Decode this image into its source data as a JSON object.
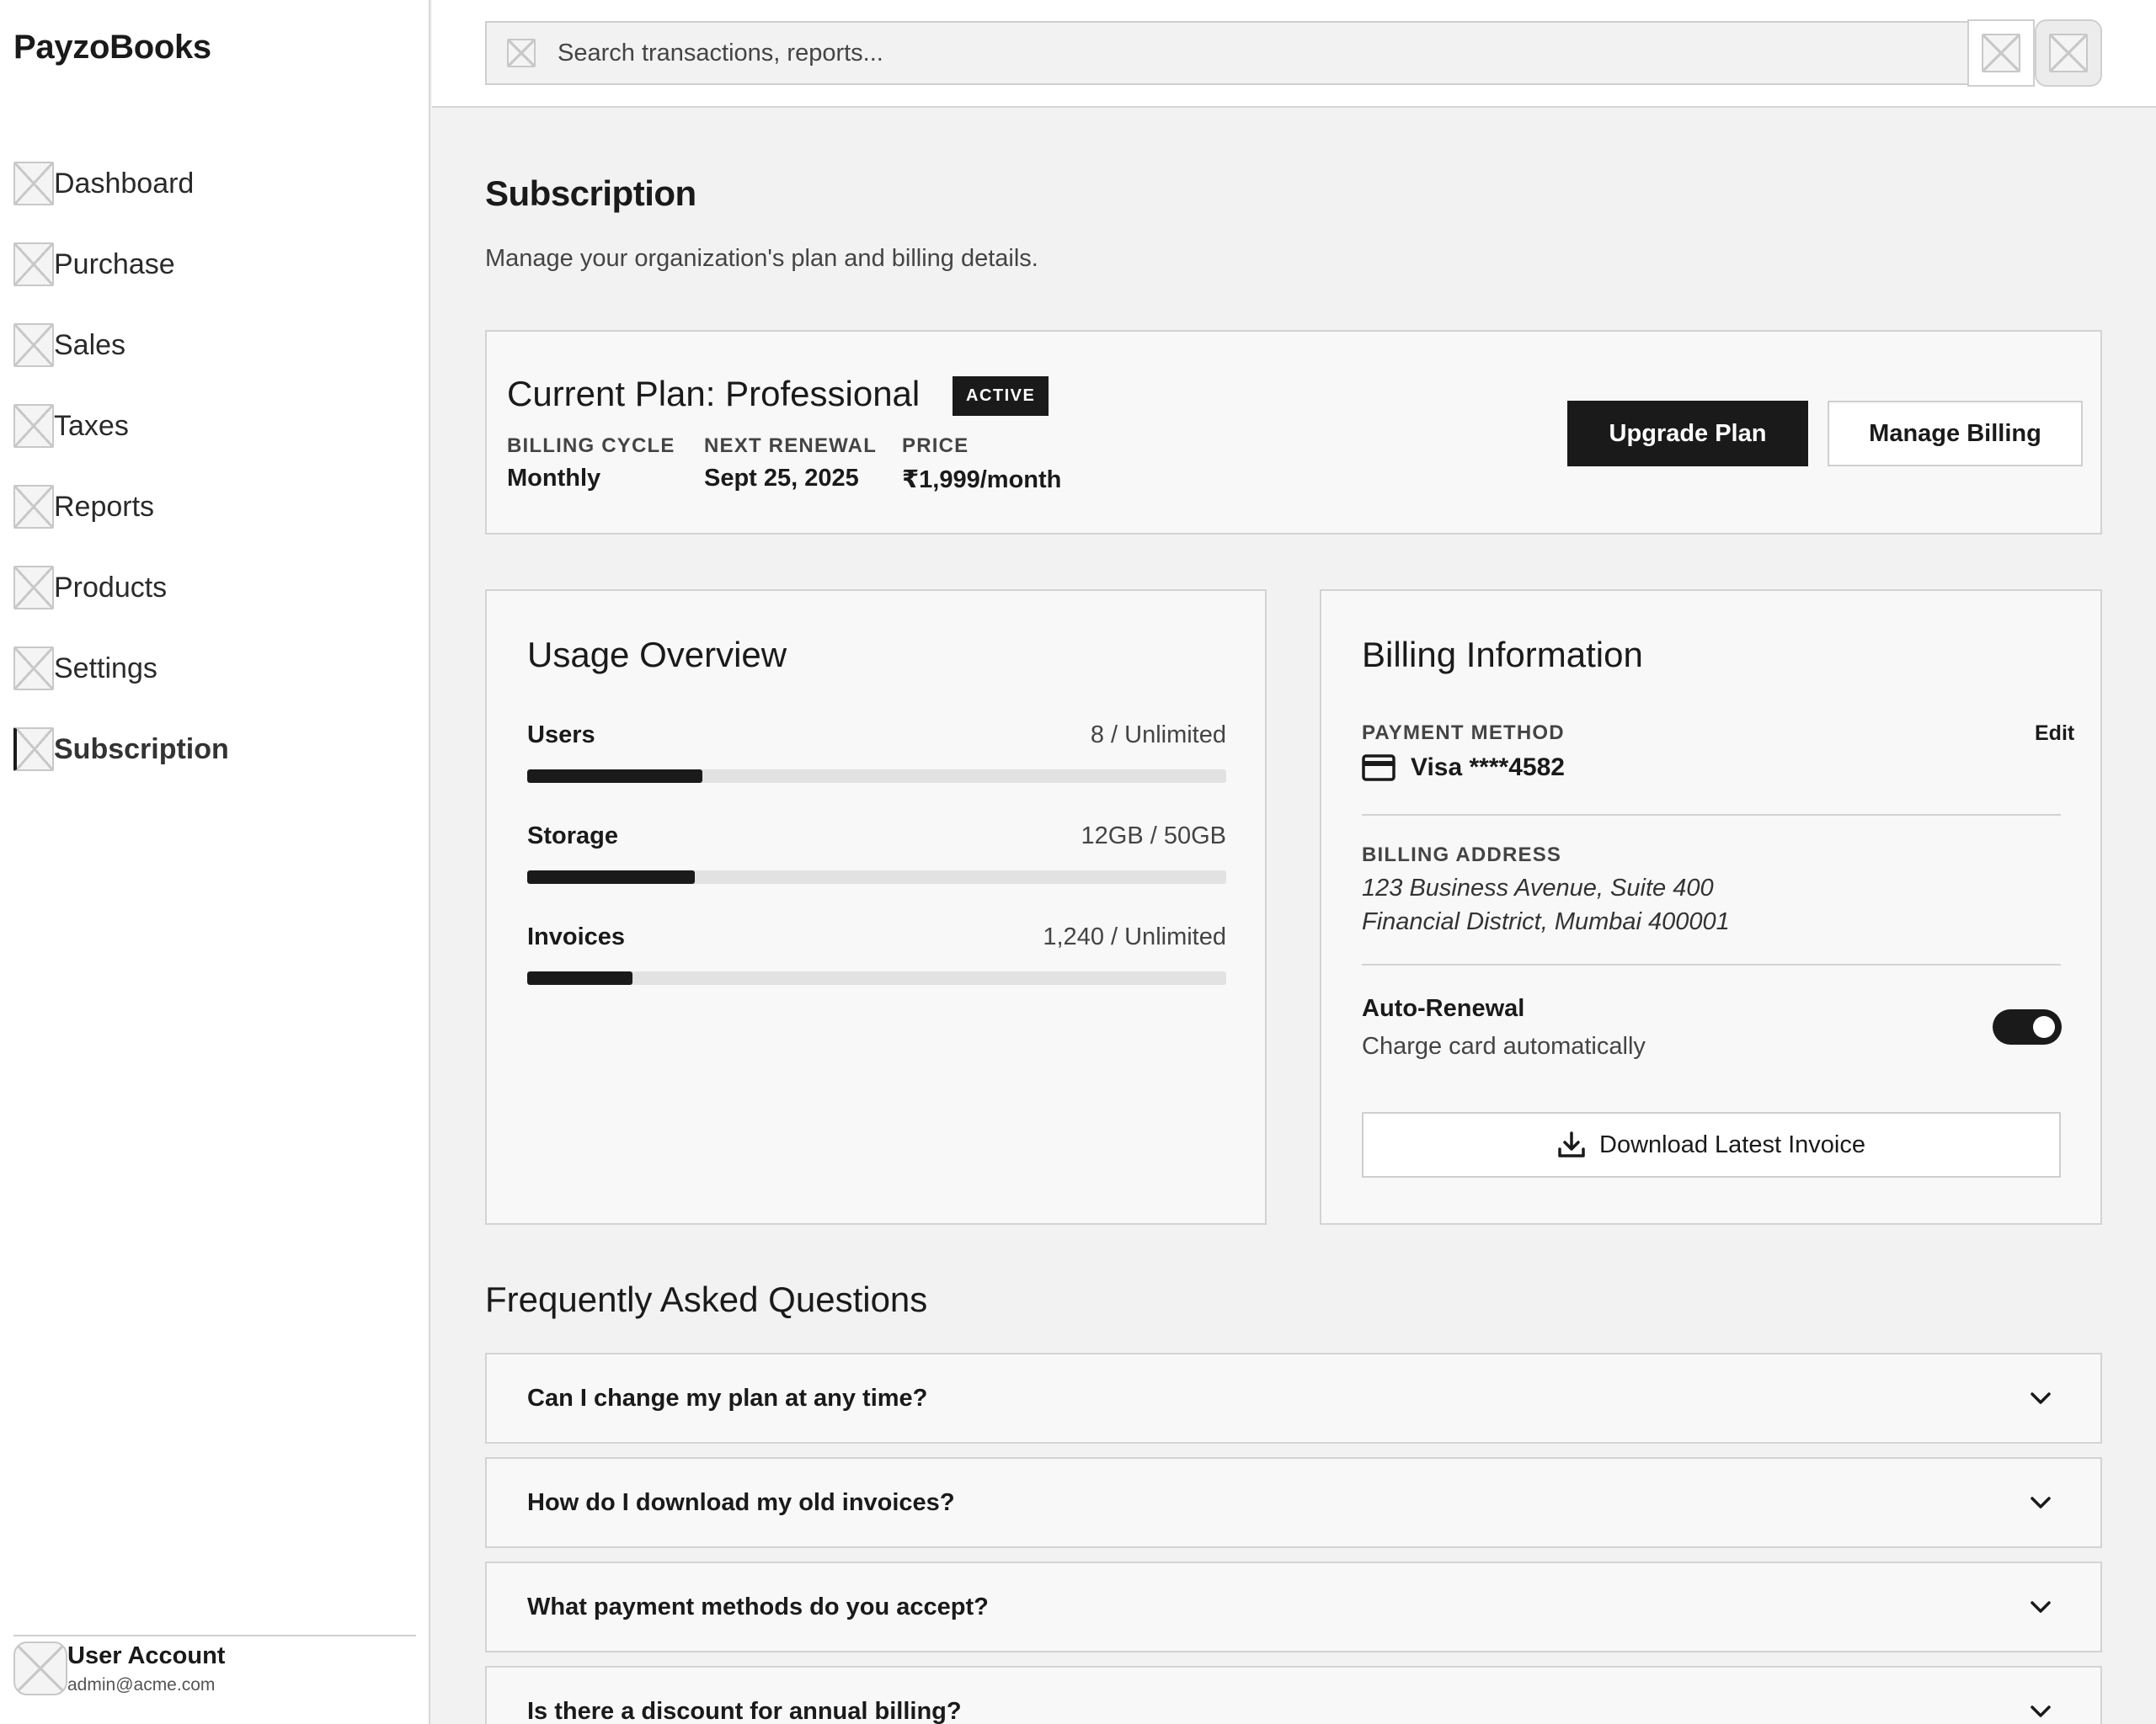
{
  "app": {
    "brand": "PayzoBooks"
  },
  "sidebar": {
    "items": [
      {
        "label": "Dashboard",
        "active": false
      },
      {
        "label": "Purchase",
        "active": false
      },
      {
        "label": "Sales",
        "active": false
      },
      {
        "label": "Taxes",
        "active": false
      },
      {
        "label": "Reports",
        "active": false
      },
      {
        "label": "Products",
        "active": false
      },
      {
        "label": "Settings",
        "active": false
      },
      {
        "label": "Subscription",
        "active": true
      }
    ],
    "user": {
      "name": "User Account",
      "email": "admin@acme.com"
    }
  },
  "search": {
    "placeholder": "Search transactions, reports..."
  },
  "page": {
    "title": "Subscription",
    "subtitle": "Manage your organization's plan and billing details."
  },
  "plan": {
    "title": "Current Plan: Professional",
    "badge": "ACTIVE",
    "billing_cycle_label": "BILLING CYCLE",
    "billing_cycle": "Monthly",
    "next_renewal_label": "NEXT RENEWAL",
    "next_renewal": "Sept 25, 2025",
    "price_label": "PRICE",
    "price": "₹1,999/month",
    "upgrade_label": "Upgrade Plan",
    "manage_label": "Manage Billing"
  },
  "usage": {
    "title": "Usage Overview",
    "metrics": [
      {
        "name": "Users",
        "value": "8 / Unlimited",
        "fill": 0.25
      },
      {
        "name": "Storage",
        "value": "12GB / 50GB",
        "fill": 0.24
      },
      {
        "name": "Invoices",
        "value": "1,240 / Unlimited",
        "fill": 0.15
      }
    ]
  },
  "billing": {
    "title": "Billing Information",
    "payment_label": "PAYMENT METHOD",
    "edit_label": "Edit",
    "card": "Visa ****4582",
    "address_label": "BILLING ADDRESS",
    "address_line1": "123 Business Avenue, Suite 400",
    "address_line2": "Financial District, Mumbai 400001",
    "auto_title": "Auto-Renewal",
    "auto_sub": "Charge card automatically",
    "auto_enabled": true,
    "download_label": "Download Latest Invoice"
  },
  "faq": {
    "title": "Frequently Asked Questions",
    "items": [
      "Can I change my plan at any time?",
      "How do I download my old invoices?",
      "What payment methods do you accept?",
      "Is there a discount for annual billing?"
    ]
  }
}
